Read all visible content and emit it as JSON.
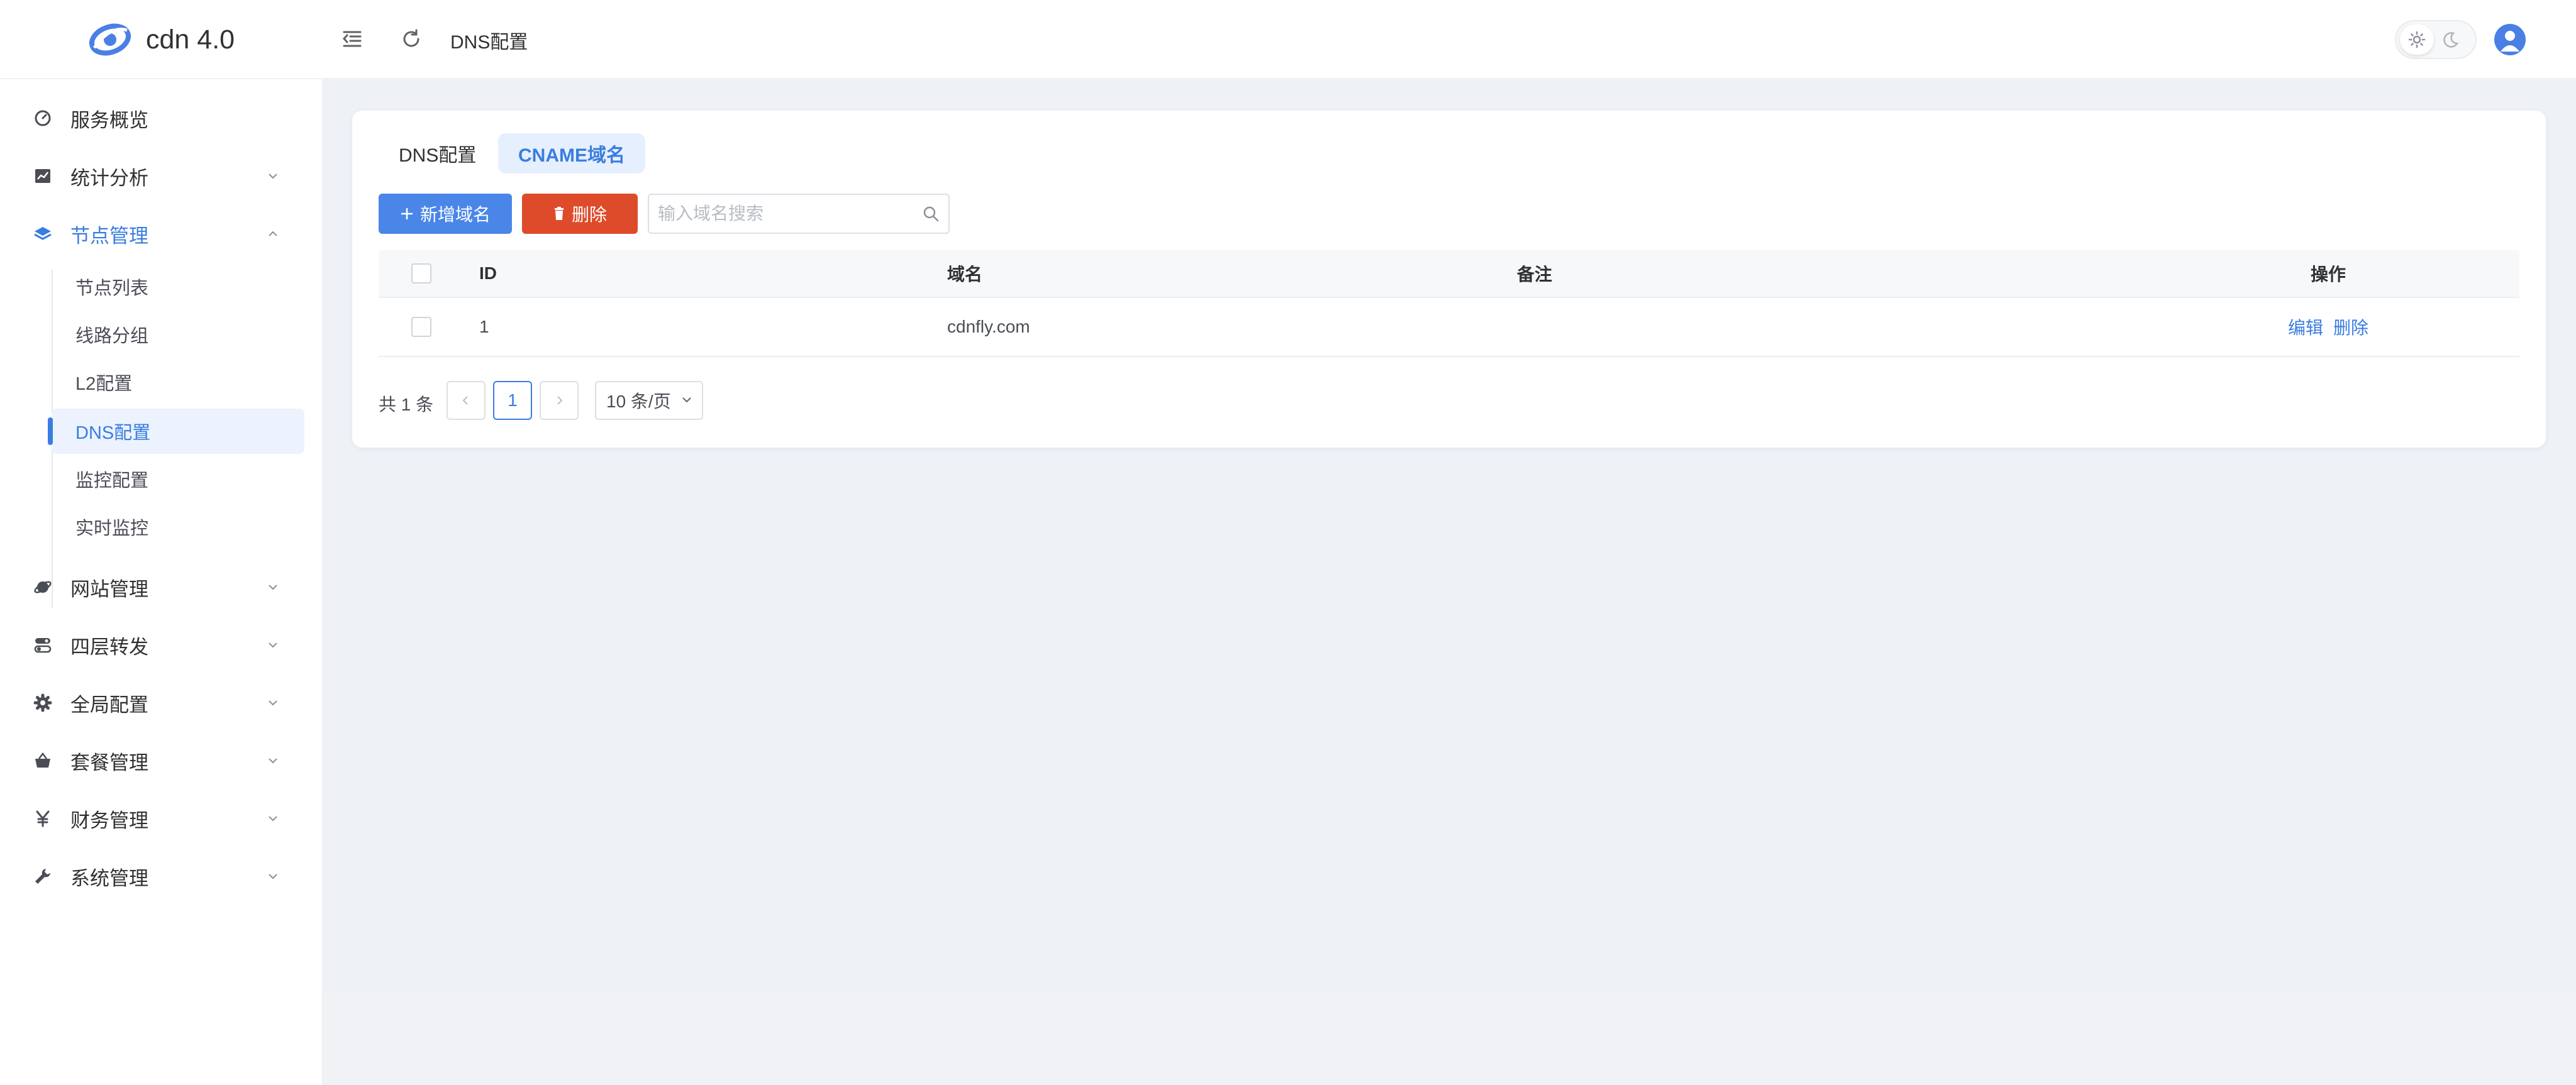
{
  "app": {
    "title": "cdn 4.0",
    "accent_color": "#3a7de0",
    "danger_color": "#de4b2a"
  },
  "header": {
    "collapse_icon": "menu-fold-icon",
    "refresh_icon": "refresh-icon",
    "page_title": "DNS配置",
    "theme": {
      "light_icon": "sun-icon",
      "dark_icon": "moon-icon",
      "active": "light"
    },
    "avatar_icon": "user-icon"
  },
  "sidebar": {
    "items": [
      {
        "label": "服务概览",
        "icon": "dashboard-icon"
      },
      {
        "label": "统计分析",
        "icon": "chart-icon"
      },
      {
        "label": "节点管理",
        "icon": "layers-icon",
        "expanded": true,
        "children": [
          {
            "label": "节点列表"
          },
          {
            "label": "线路分组"
          },
          {
            "label": "L2配置"
          },
          {
            "label": "DNS配置",
            "active": true
          },
          {
            "label": "监控配置"
          },
          {
            "label": "实时监控"
          }
        ]
      },
      {
        "label": "网站管理",
        "icon": "globe-icon"
      },
      {
        "label": "四层转发",
        "icon": "toggle-icon"
      },
      {
        "label": "全局配置",
        "icon": "gear-icon"
      },
      {
        "label": "套餐管理",
        "icon": "basket-icon"
      },
      {
        "label": "财务管理",
        "icon": "yen-icon"
      },
      {
        "label": "系统管理",
        "icon": "wrench-icon"
      }
    ]
  },
  "main": {
    "tabs": [
      {
        "label": "DNS配置",
        "active": false
      },
      {
        "label": "CNAME域名",
        "active": true
      }
    ],
    "toolbar": {
      "add_label": "新增域名",
      "delete_label": "删除",
      "search_placeholder": "输入域名搜索",
      "search_value": ""
    },
    "table": {
      "columns": [
        "ID",
        "域名",
        "备注",
        "操作"
      ],
      "rows": [
        {
          "id": "1",
          "domain": "cdnfly.com",
          "note": "",
          "actions": [
            "编辑",
            "删除"
          ]
        }
      ]
    },
    "pagination": {
      "total_text": "共 1 条",
      "current_page": "1",
      "page_size": "10 条/页"
    }
  }
}
